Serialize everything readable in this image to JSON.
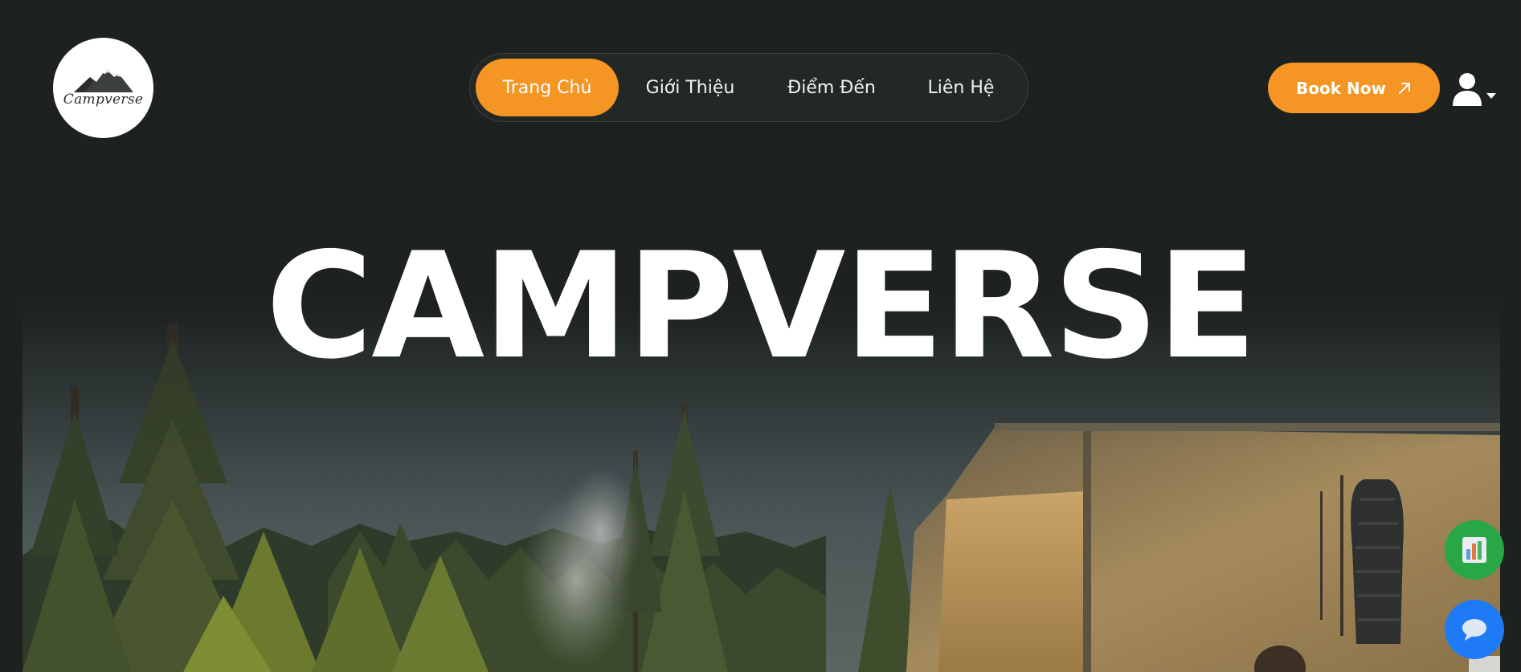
{
  "brand": {
    "logo_text": "Campverse",
    "logo_icon": "mountain-icon"
  },
  "nav": {
    "items": [
      {
        "label": "Trang Chủ",
        "active": true
      },
      {
        "label": "Giới Thiệu",
        "active": false
      },
      {
        "label": "Điểm Đến",
        "active": false
      },
      {
        "label": "Liên Hệ",
        "active": false
      }
    ]
  },
  "header": {
    "book_label": "Book Now",
    "book_icon": "arrow-up-right-icon",
    "user_icon": "user-icon",
    "user_caret_icon": "caret-down-icon"
  },
  "hero": {
    "title": "CAMPVERSE",
    "image": "forest-campsite-tent-photo"
  },
  "floating": {
    "stats_icon": "bar-chart-icon",
    "chat_icon": "chat-bubble-icon"
  },
  "colors": {
    "background": "#1d2120",
    "accent": "#f49524",
    "nav_pill": "#232826",
    "stats_button": "#27a845",
    "chat_button": "#1f7af5",
    "text": "#ffffff"
  }
}
